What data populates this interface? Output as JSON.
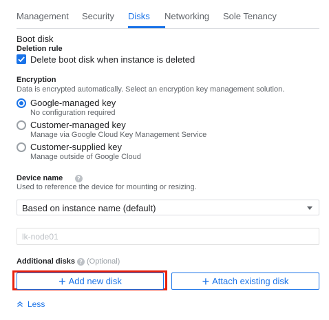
{
  "tabs": [
    {
      "label": "Management",
      "active": false
    },
    {
      "label": "Security",
      "active": false
    },
    {
      "label": "Disks",
      "active": true
    },
    {
      "label": "Networking",
      "active": false
    },
    {
      "label": "Sole Tenancy",
      "active": false
    }
  ],
  "boot_disk": {
    "heading": "Boot disk",
    "deletion_rule_label": "Deletion rule",
    "delete_checkbox_label": "Delete boot disk when instance is deleted",
    "delete_checked": true
  },
  "encryption": {
    "heading": "Encryption",
    "description": "Data is encrypted automatically. Select an encryption key management solution.",
    "options": [
      {
        "label": "Google-managed key",
        "sub": "No configuration required",
        "selected": true
      },
      {
        "label": "Customer-managed key",
        "sub": "Manage via Google Cloud Key Management Service",
        "selected": false
      },
      {
        "label": "Customer-supplied key",
        "sub": "Manage outside of Google Cloud",
        "selected": false
      }
    ]
  },
  "device_name": {
    "heading": "Device name",
    "help_icon": "help-icon",
    "description": "Used to reference the device for mounting or resizing.",
    "select_value": "Based on instance name (default)",
    "input_value": "lk-node01"
  },
  "additional_disks": {
    "heading": "Additional disks",
    "optional_label": "(Optional)",
    "add_button": "Add new disk",
    "attach_button": "Attach existing disk",
    "plus_glyph": "+"
  },
  "less_link": "Less",
  "colors": {
    "accent": "#1a73e8",
    "highlight": "#e8200d",
    "text_primary": "#202124",
    "text_secondary": "#5f6368"
  }
}
